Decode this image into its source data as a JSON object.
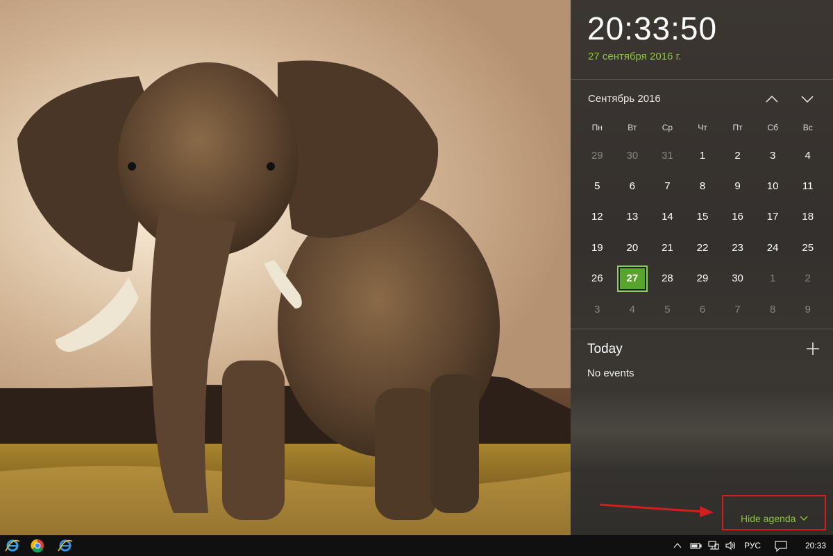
{
  "clock": {
    "time": "20:33:50",
    "date": "27 сентября 2016 г."
  },
  "calendar": {
    "month_label": "Сентябрь 2016",
    "weekdays": [
      "Пн",
      "Вт",
      "Ср",
      "Чт",
      "Пт",
      "Сб",
      "Вс"
    ],
    "weeks": [
      [
        {
          "d": "29",
          "muted": true
        },
        {
          "d": "30",
          "muted": true
        },
        {
          "d": "31",
          "muted": true
        },
        {
          "d": "1"
        },
        {
          "d": "2"
        },
        {
          "d": "3"
        },
        {
          "d": "4"
        }
      ],
      [
        {
          "d": "5"
        },
        {
          "d": "6"
        },
        {
          "d": "7"
        },
        {
          "d": "8"
        },
        {
          "d": "9"
        },
        {
          "d": "10"
        },
        {
          "d": "11"
        }
      ],
      [
        {
          "d": "12"
        },
        {
          "d": "13"
        },
        {
          "d": "14"
        },
        {
          "d": "15"
        },
        {
          "d": "16"
        },
        {
          "d": "17"
        },
        {
          "d": "18"
        }
      ],
      [
        {
          "d": "19"
        },
        {
          "d": "20"
        },
        {
          "d": "21"
        },
        {
          "d": "22"
        },
        {
          "d": "23"
        },
        {
          "d": "24"
        },
        {
          "d": "25"
        }
      ],
      [
        {
          "d": "26"
        },
        {
          "d": "27",
          "today": true
        },
        {
          "d": "28"
        },
        {
          "d": "29"
        },
        {
          "d": "30"
        },
        {
          "d": "1",
          "muted": true
        },
        {
          "d": "2",
          "muted": true
        }
      ],
      [
        {
          "d": "3",
          "muted": true
        },
        {
          "d": "4",
          "muted": true
        },
        {
          "d": "5",
          "muted": true
        },
        {
          "d": "6",
          "muted": true
        },
        {
          "d": "7",
          "muted": true
        },
        {
          "d": "8",
          "muted": true
        },
        {
          "d": "9",
          "muted": true
        }
      ]
    ],
    "selected_day": "27"
  },
  "agenda": {
    "title": "Today",
    "empty_text": "No events",
    "hide_label": "Hide agenda"
  },
  "taskbar": {
    "apps": [
      "internet-explorer-icon",
      "chrome-icon",
      "edge-icon"
    ],
    "language": "РУС",
    "time": "20:33"
  },
  "colors": {
    "accent": "#8cc63f",
    "today_fill": "#58a52d",
    "annotation": "#d11f1f"
  }
}
